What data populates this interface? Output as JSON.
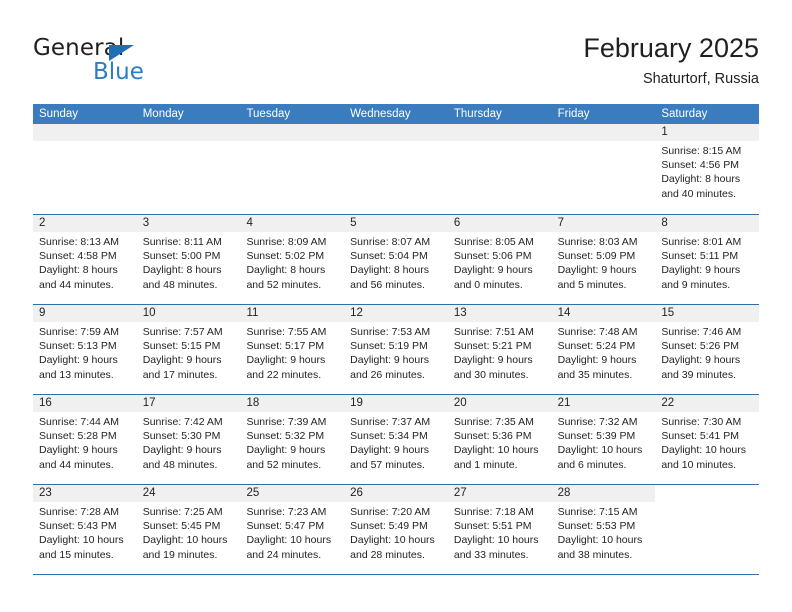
{
  "brand": {
    "name_part1": "General",
    "name_part2": "Blue",
    "triangle_icon": "brand-triangle-icon",
    "accent_color": "#2b7cc4"
  },
  "header": {
    "month_title": "February 2025",
    "location": "Shaturtorf, Russia"
  },
  "calendar": {
    "header_color": "#3a7cbe",
    "weekdays": [
      "Sunday",
      "Monday",
      "Tuesday",
      "Wednesday",
      "Thursday",
      "Friday",
      "Saturday"
    ],
    "weeks": [
      [
        {
          "date": "",
          "blank": true
        },
        {
          "date": "",
          "blank": true
        },
        {
          "date": "",
          "blank": true
        },
        {
          "date": "",
          "blank": true
        },
        {
          "date": "",
          "blank": true
        },
        {
          "date": "",
          "blank": true
        },
        {
          "date": "1",
          "sunrise": "Sunrise: 8:15 AM",
          "sunset": "Sunset: 4:56 PM",
          "daylight_line1": "Daylight: 8 hours",
          "daylight_line2": "and 40 minutes."
        }
      ],
      [
        {
          "date": "2",
          "sunrise": "Sunrise: 8:13 AM",
          "sunset": "Sunset: 4:58 PM",
          "daylight_line1": "Daylight: 8 hours",
          "daylight_line2": "and 44 minutes."
        },
        {
          "date": "3",
          "sunrise": "Sunrise: 8:11 AM",
          "sunset": "Sunset: 5:00 PM",
          "daylight_line1": "Daylight: 8 hours",
          "daylight_line2": "and 48 minutes."
        },
        {
          "date": "4",
          "sunrise": "Sunrise: 8:09 AM",
          "sunset": "Sunset: 5:02 PM",
          "daylight_line1": "Daylight: 8 hours",
          "daylight_line2": "and 52 minutes."
        },
        {
          "date": "5",
          "sunrise": "Sunrise: 8:07 AM",
          "sunset": "Sunset: 5:04 PM",
          "daylight_line1": "Daylight: 8 hours",
          "daylight_line2": "and 56 minutes."
        },
        {
          "date": "6",
          "sunrise": "Sunrise: 8:05 AM",
          "sunset": "Sunset: 5:06 PM",
          "daylight_line1": "Daylight: 9 hours",
          "daylight_line2": "and 0 minutes."
        },
        {
          "date": "7",
          "sunrise": "Sunrise: 8:03 AM",
          "sunset": "Sunset: 5:09 PM",
          "daylight_line1": "Daylight: 9 hours",
          "daylight_line2": "and 5 minutes."
        },
        {
          "date": "8",
          "sunrise": "Sunrise: 8:01 AM",
          "sunset": "Sunset: 5:11 PM",
          "daylight_line1": "Daylight: 9 hours",
          "daylight_line2": "and 9 minutes."
        }
      ],
      [
        {
          "date": "9",
          "sunrise": "Sunrise: 7:59 AM",
          "sunset": "Sunset: 5:13 PM",
          "daylight_line1": "Daylight: 9 hours",
          "daylight_line2": "and 13 minutes."
        },
        {
          "date": "10",
          "sunrise": "Sunrise: 7:57 AM",
          "sunset": "Sunset: 5:15 PM",
          "daylight_line1": "Daylight: 9 hours",
          "daylight_line2": "and 17 minutes."
        },
        {
          "date": "11",
          "sunrise": "Sunrise: 7:55 AM",
          "sunset": "Sunset: 5:17 PM",
          "daylight_line1": "Daylight: 9 hours",
          "daylight_line2": "and 22 minutes."
        },
        {
          "date": "12",
          "sunrise": "Sunrise: 7:53 AM",
          "sunset": "Sunset: 5:19 PM",
          "daylight_line1": "Daylight: 9 hours",
          "daylight_line2": "and 26 minutes."
        },
        {
          "date": "13",
          "sunrise": "Sunrise: 7:51 AM",
          "sunset": "Sunset: 5:21 PM",
          "daylight_line1": "Daylight: 9 hours",
          "daylight_line2": "and 30 minutes."
        },
        {
          "date": "14",
          "sunrise": "Sunrise: 7:48 AM",
          "sunset": "Sunset: 5:24 PM",
          "daylight_line1": "Daylight: 9 hours",
          "daylight_line2": "and 35 minutes."
        },
        {
          "date": "15",
          "sunrise": "Sunrise: 7:46 AM",
          "sunset": "Sunset: 5:26 PM",
          "daylight_line1": "Daylight: 9 hours",
          "daylight_line2": "and 39 minutes."
        }
      ],
      [
        {
          "date": "16",
          "sunrise": "Sunrise: 7:44 AM",
          "sunset": "Sunset: 5:28 PM",
          "daylight_line1": "Daylight: 9 hours",
          "daylight_line2": "and 44 minutes."
        },
        {
          "date": "17",
          "sunrise": "Sunrise: 7:42 AM",
          "sunset": "Sunset: 5:30 PM",
          "daylight_line1": "Daylight: 9 hours",
          "daylight_line2": "and 48 minutes."
        },
        {
          "date": "18",
          "sunrise": "Sunrise: 7:39 AM",
          "sunset": "Sunset: 5:32 PM",
          "daylight_line1": "Daylight: 9 hours",
          "daylight_line2": "and 52 minutes."
        },
        {
          "date": "19",
          "sunrise": "Sunrise: 7:37 AM",
          "sunset": "Sunset: 5:34 PM",
          "daylight_line1": "Daylight: 9 hours",
          "daylight_line2": "and 57 minutes."
        },
        {
          "date": "20",
          "sunrise": "Sunrise: 7:35 AM",
          "sunset": "Sunset: 5:36 PM",
          "daylight_line1": "Daylight: 10 hours",
          "daylight_line2": "and 1 minute."
        },
        {
          "date": "21",
          "sunrise": "Sunrise: 7:32 AM",
          "sunset": "Sunset: 5:39 PM",
          "daylight_line1": "Daylight: 10 hours",
          "daylight_line2": "and 6 minutes."
        },
        {
          "date": "22",
          "sunrise": "Sunrise: 7:30 AM",
          "sunset": "Sunset: 5:41 PM",
          "daylight_line1": "Daylight: 10 hours",
          "daylight_line2": "and 10 minutes."
        }
      ],
      [
        {
          "date": "23",
          "sunrise": "Sunrise: 7:28 AM",
          "sunset": "Sunset: 5:43 PM",
          "daylight_line1": "Daylight: 10 hours",
          "daylight_line2": "and 15 minutes."
        },
        {
          "date": "24",
          "sunrise": "Sunrise: 7:25 AM",
          "sunset": "Sunset: 5:45 PM",
          "daylight_line1": "Daylight: 10 hours",
          "daylight_line2": "and 19 minutes."
        },
        {
          "date": "25",
          "sunrise": "Sunrise: 7:23 AM",
          "sunset": "Sunset: 5:47 PM",
          "daylight_line1": "Daylight: 10 hours",
          "daylight_line2": "and 24 minutes."
        },
        {
          "date": "26",
          "sunrise": "Sunrise: 7:20 AM",
          "sunset": "Sunset: 5:49 PM",
          "daylight_line1": "Daylight: 10 hours",
          "daylight_line2": "and 28 minutes."
        },
        {
          "date": "27",
          "sunrise": "Sunrise: 7:18 AM",
          "sunset": "Sunset: 5:51 PM",
          "daylight_line1": "Daylight: 10 hours",
          "daylight_line2": "and 33 minutes."
        },
        {
          "date": "28",
          "sunrise": "Sunrise: 7:15 AM",
          "sunset": "Sunset: 5:53 PM",
          "daylight_line1": "Daylight: 10 hours",
          "daylight_line2": "and 38 minutes."
        },
        {
          "date": "",
          "void": true
        }
      ]
    ]
  }
}
